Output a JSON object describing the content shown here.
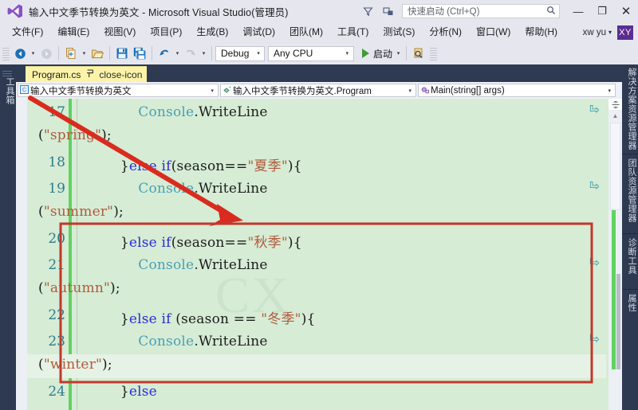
{
  "window": {
    "title": "输入中文季节转换为英文 - Microsoft Visual Studio(管理员)",
    "logo_icon": "visual-studio-logo-icon",
    "controls": {
      "feedback_icon": "feedback-funnel-icon",
      "notify_icon": "notifications-icon",
      "minimize": "—",
      "maximize": "❐",
      "close": "✕"
    },
    "quick_launch": {
      "placeholder": "快速启动 (Ctrl+Q)",
      "icon": "search-icon"
    }
  },
  "menu": {
    "items": [
      {
        "label": "文件(F)"
      },
      {
        "label": "编辑(E)"
      },
      {
        "label": "视图(V)"
      },
      {
        "label": "项目(P)"
      },
      {
        "label": "生成(B)"
      },
      {
        "label": "调试(D)"
      },
      {
        "label": "团队(M)"
      },
      {
        "label": "工具(T)"
      },
      {
        "label": "测试(S)"
      },
      {
        "label": "分析(N)"
      },
      {
        "label": "窗口(W)"
      },
      {
        "label": "帮助(H)"
      }
    ],
    "account": {
      "user": "xw yu",
      "caret": "▾",
      "avatar_initials": "XY",
      "avatar_color": "#5c2d91"
    }
  },
  "toolbar": {
    "back_icon": "navigate-back-icon",
    "forward_icon": "navigate-forward-icon",
    "new_project_icon": "new-project-icon",
    "open_file_icon": "open-file-icon",
    "save_icon": "save-icon",
    "save_all_icon": "save-all-icon",
    "undo_icon": "undo-icon",
    "redo_icon": "redo-icon",
    "caret": "▾",
    "configuration": "Debug",
    "platform": "Any CPU",
    "start_label": "启动",
    "start_icon": "play-icon",
    "find_icon": "find-in-files-icon",
    "overflow_icon": "toolbar-overflow-icon",
    "accent": "#3f9c35"
  },
  "docks": {
    "left": [
      {
        "label": "工具箱",
        "name": "toolbox"
      }
    ],
    "right": [
      {
        "label": "解决方案资源管理器",
        "name": "solution-explorer"
      },
      {
        "label": "团队资源管理器",
        "name": "team-explorer"
      },
      {
        "label": "诊断工具",
        "name": "diagnostic-tools"
      },
      {
        "label": "属性",
        "name": "properties"
      }
    ]
  },
  "document_tab": {
    "name": "Program.cs",
    "pin_icon": "pin-icon",
    "close_icon": "close-icon"
  },
  "navbar": {
    "project": "输入中文季节转换为英文",
    "project_icon": "csharp-project-icon",
    "type": "输入中文季节转换为英文.Program",
    "type_icon": "class-icon",
    "member": "Main(string[] args)",
    "member_icon": "method-icon",
    "caret": "▾"
  },
  "editor": {
    "watermark": "CX",
    "wrap_glyph": "⏎",
    "current_line": 23,
    "lines": [
      {
        "number": 17,
        "segments": [
          {
            "t": "            ",
            "c": "punct"
          },
          {
            "t": "Console",
            "c": "cls"
          },
          {
            "t": ".WriteLine",
            "c": "punct"
          }
        ],
        "wrapped": [
          {
            "t": "(",
            "c": "punct"
          },
          {
            "t": "\"spring\"",
            "c": "str"
          },
          {
            "t": ");",
            "c": "punct"
          }
        ]
      },
      {
        "number": 18,
        "segments": [
          {
            "t": "        }",
            "c": "punct"
          },
          {
            "t": "else if",
            "c": "k"
          },
          {
            "t": "(season==",
            "c": "punct"
          },
          {
            "t": "\"夏季\"",
            "c": "str"
          },
          {
            "t": "){",
            "c": "punct"
          }
        ],
        "wrapped": null
      },
      {
        "number": 19,
        "segments": [
          {
            "t": "            ",
            "c": "punct"
          },
          {
            "t": "Console",
            "c": "cls"
          },
          {
            "t": ".WriteLine",
            "c": "punct"
          }
        ],
        "wrapped": [
          {
            "t": "(",
            "c": "punct"
          },
          {
            "t": "\"summer\"",
            "c": "str"
          },
          {
            "t": ");",
            "c": "punct"
          }
        ]
      },
      {
        "number": 20,
        "segments": [
          {
            "t": "        }",
            "c": "punct"
          },
          {
            "t": "else if",
            "c": "k"
          },
          {
            "t": "(season==",
            "c": "punct"
          },
          {
            "t": "\"秋季\"",
            "c": "str"
          },
          {
            "t": "){",
            "c": "punct"
          }
        ],
        "wrapped": null
      },
      {
        "number": 21,
        "segments": [
          {
            "t": "            ",
            "c": "punct"
          },
          {
            "t": "Console",
            "c": "cls"
          },
          {
            "t": ".WriteLine",
            "c": "punct"
          }
        ],
        "wrapped": [
          {
            "t": "(",
            "c": "punct"
          },
          {
            "t": "\"autumn\"",
            "c": "str"
          },
          {
            "t": ");",
            "c": "punct"
          }
        ]
      },
      {
        "number": 22,
        "segments": [
          {
            "t": "        }",
            "c": "punct"
          },
          {
            "t": "else if",
            "c": "k"
          },
          {
            "t": " (season == ",
            "c": "punct"
          },
          {
            "t": "\"冬季\"",
            "c": "str"
          },
          {
            "t": "){",
            "c": "punct"
          }
        ],
        "wrapped": null
      },
      {
        "number": 23,
        "segments": [
          {
            "t": "            ",
            "c": "punct"
          },
          {
            "t": "Console",
            "c": "cls"
          },
          {
            "t": ".WriteLine",
            "c": "punct"
          }
        ],
        "wrapped": [
          {
            "t": "(",
            "c": "punct"
          },
          {
            "t": "\"winter\"",
            "c": "str"
          },
          {
            "t": ");",
            "c": "punct"
          }
        ]
      },
      {
        "number": 24,
        "segments": [
          {
            "t": "        }",
            "c": "punct"
          },
          {
            "t": "else",
            "c": "k"
          }
        ],
        "wrapped": null
      }
    ],
    "scrollbar": {
      "split_icon": "split-view-icon",
      "up_icon": "scroll-up-icon"
    }
  },
  "annotations": {
    "arrow_color": "#d92b1f",
    "box_color": "#c0392b",
    "arrow_label": "pointer-arrow",
    "box_label": "highlight-rectangle"
  }
}
